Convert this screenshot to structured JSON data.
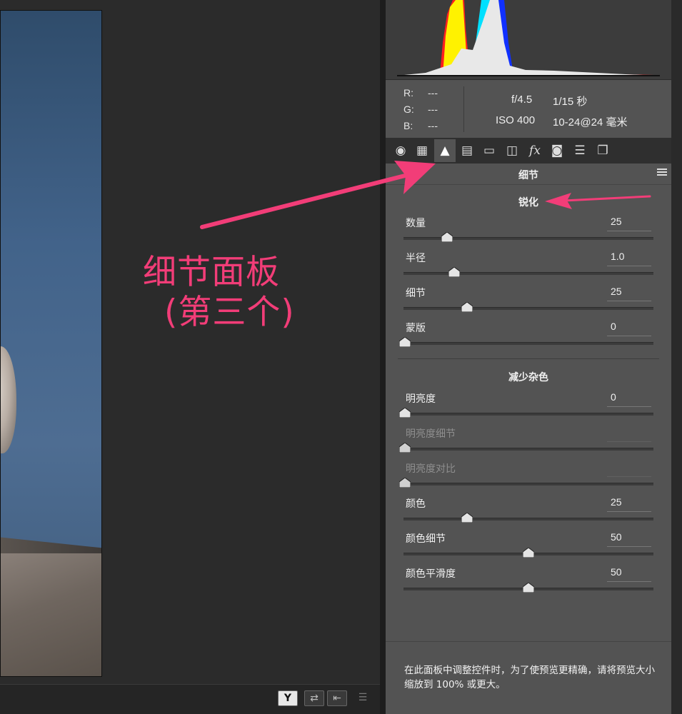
{
  "histogram": {
    "colors": {
      "red": "#ff1f1f",
      "yellow": "#fff200",
      "cyan": "#00e0ff",
      "blue": "#1030ff",
      "white": "#e8e8e8"
    }
  },
  "rgb": {
    "r_label": "R:",
    "r_value": "---",
    "g_label": "G:",
    "g_value": "---",
    "b_label": "B:",
    "b_value": "---"
  },
  "camera": {
    "aperture": "f/4.5",
    "shutter": "1/15 秒",
    "iso": "ISO 400",
    "lens": "10-24@24 毫米"
  },
  "tabs": [
    {
      "icon": "aperture-icon",
      "glyph": "◉"
    },
    {
      "icon": "tone-curve-icon",
      "glyph": "▦"
    },
    {
      "icon": "detail-icon",
      "glyph": "▲"
    },
    {
      "icon": "hsl-icon",
      "glyph": "▤"
    },
    {
      "icon": "split-toning-icon",
      "glyph": "▭"
    },
    {
      "icon": "lens-corrections-icon",
      "glyph": "◫"
    },
    {
      "icon": "effects-icon",
      "glyph": "fx"
    },
    {
      "icon": "camera-calibration-icon",
      "glyph": "◙"
    },
    {
      "icon": "presets-icon",
      "glyph": "☰"
    },
    {
      "icon": "snapshots-icon",
      "glyph": "❐"
    }
  ],
  "panel_title": "细节",
  "sharpening": {
    "heading": "锐化",
    "controls": [
      {
        "label": "数量",
        "value": "25",
        "level": 0.17
      },
      {
        "label": "半径",
        "value": "1.0",
        "level": 0.2
      },
      {
        "label": "细节",
        "value": "25",
        "level": 0.25
      },
      {
        "label": "蒙版",
        "value": "0",
        "level": 0.0
      }
    ]
  },
  "noise_reduction": {
    "heading": "减少杂色",
    "controls": [
      {
        "label": "明亮度",
        "value": "0",
        "level": 0.0,
        "disabled": false
      },
      {
        "label": "明亮度细节",
        "value": "",
        "level": 0.0,
        "disabled": true
      },
      {
        "label": "明亮度对比",
        "value": "",
        "level": 0.0,
        "disabled": true
      },
      {
        "label": "颜色",
        "value": "25",
        "level": 0.25,
        "disabled": false
      },
      {
        "label": "颜色细节",
        "value": "50",
        "level": 0.5,
        "disabled": false
      },
      {
        "label": "颜色平滑度",
        "value": "50",
        "level": 0.5,
        "disabled": false
      }
    ]
  },
  "footer_note": "在此面板中调整控件时，为了使预览更精确，请将预览大小缩放到 100% 或更大。",
  "bottom_bar": {
    "y_button": "Y",
    "swap_button": "⇄",
    "copy_button": "⇤",
    "settings_button": "☰"
  },
  "annotation": {
    "title": "细节面板",
    "subtitle": "(第三个)",
    "color": "#f23d78"
  }
}
